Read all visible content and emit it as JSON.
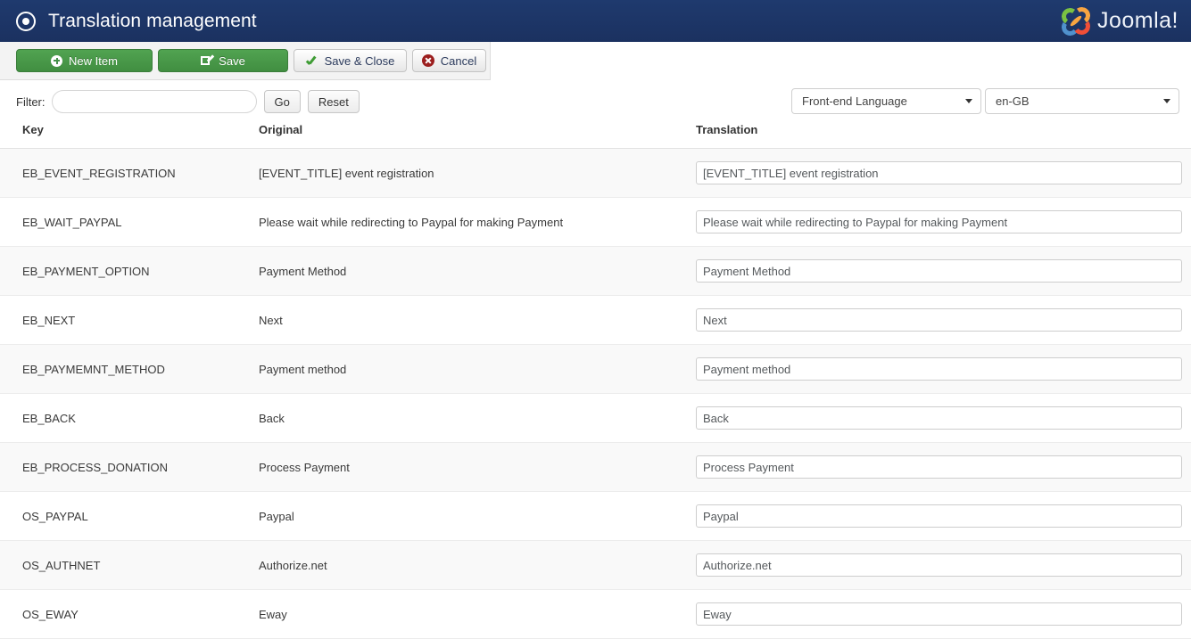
{
  "header": {
    "title": "Translation management",
    "icon": "target-circle-icon",
    "brand": "Joomla!",
    "brand_tm": "®",
    "background_color": "#1c3566"
  },
  "toolbar": {
    "buttons": [
      {
        "label": "New Item",
        "icon": "plus-circle-icon",
        "style": "green"
      },
      {
        "label": "Save",
        "icon": "edit-pencil-icon",
        "style": "green"
      },
      {
        "label": "Save & Close",
        "icon": "check-icon",
        "style": "grey"
      },
      {
        "label": "Cancel",
        "icon": "cancel-circle-icon",
        "style": "grey"
      }
    ]
  },
  "filter": {
    "label": "Filter:",
    "value": "",
    "placeholder": "",
    "go_label": "Go",
    "reset_label": "Reset"
  },
  "selects": {
    "language_scope": {
      "value": "Front-end Language"
    },
    "language_code": {
      "value": "en-GB"
    }
  },
  "table": {
    "columns": [
      "Key",
      "Original",
      "Translation"
    ],
    "rows": [
      {
        "key": "EB_EVENT_REGISTRATION",
        "original": "[EVENT_TITLE] event registration",
        "translation": "[EVENT_TITLE] event registration"
      },
      {
        "key": "EB_WAIT_PAYPAL",
        "original": "Please wait while redirecting to Paypal for making Payment",
        "translation": "Please wait while redirecting to Paypal for making Payment"
      },
      {
        "key": "EB_PAYMENT_OPTION",
        "original": "Payment Method",
        "translation": "Payment Method"
      },
      {
        "key": "EB_NEXT",
        "original": "Next",
        "translation": "Next"
      },
      {
        "key": "EB_PAYMEMNT_METHOD",
        "original": "Payment method",
        "translation": "Payment method"
      },
      {
        "key": "EB_BACK",
        "original": "Back",
        "translation": "Back"
      },
      {
        "key": "EB_PROCESS_DONATION",
        "original": "Process Payment",
        "translation": "Process Payment"
      },
      {
        "key": "OS_PAYPAL",
        "original": "Paypal",
        "translation": "Paypal"
      },
      {
        "key": "OS_AUTHNET",
        "original": "Authorize.net",
        "translation": "Authorize.net"
      },
      {
        "key": "OS_EWAY",
        "original": "Eway",
        "translation": "Eway"
      }
    ]
  }
}
